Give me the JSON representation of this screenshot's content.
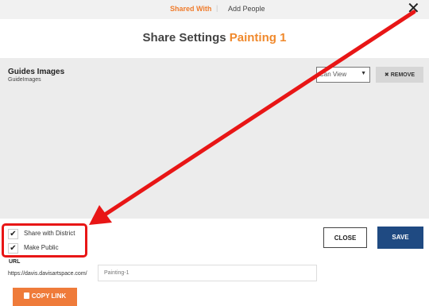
{
  "tabs": {
    "shared_with": "Shared With",
    "separator": "|",
    "add_people": "Add People"
  },
  "close_icon_glyph": "✕",
  "title": {
    "prefix": "Share Settings",
    "item": "Painting 1"
  },
  "shared_item": {
    "name": "Guides Images",
    "sub": "GuideImages",
    "permission": "Can View",
    "remove_label": "✖ REMOVE"
  },
  "options": {
    "share_with_district": "Share with District",
    "make_public": "Make Public",
    "check_glyph": "✔"
  },
  "url": {
    "label": "URL",
    "prefix": "https://davis.davisartspace.com/",
    "value": "Painting-1"
  },
  "buttons": {
    "copy_link": "COPY LINK",
    "close": "CLOSE",
    "save": "SAVE"
  },
  "colors": {
    "accent_orange": "#f07c2c",
    "save_blue": "#1f4a82",
    "annotation_red": "#e81616"
  },
  "icons": [
    "close-icon",
    "chevron-down-icon",
    "checkmark-icon",
    "copy-icon",
    "annotation-arrow"
  ]
}
